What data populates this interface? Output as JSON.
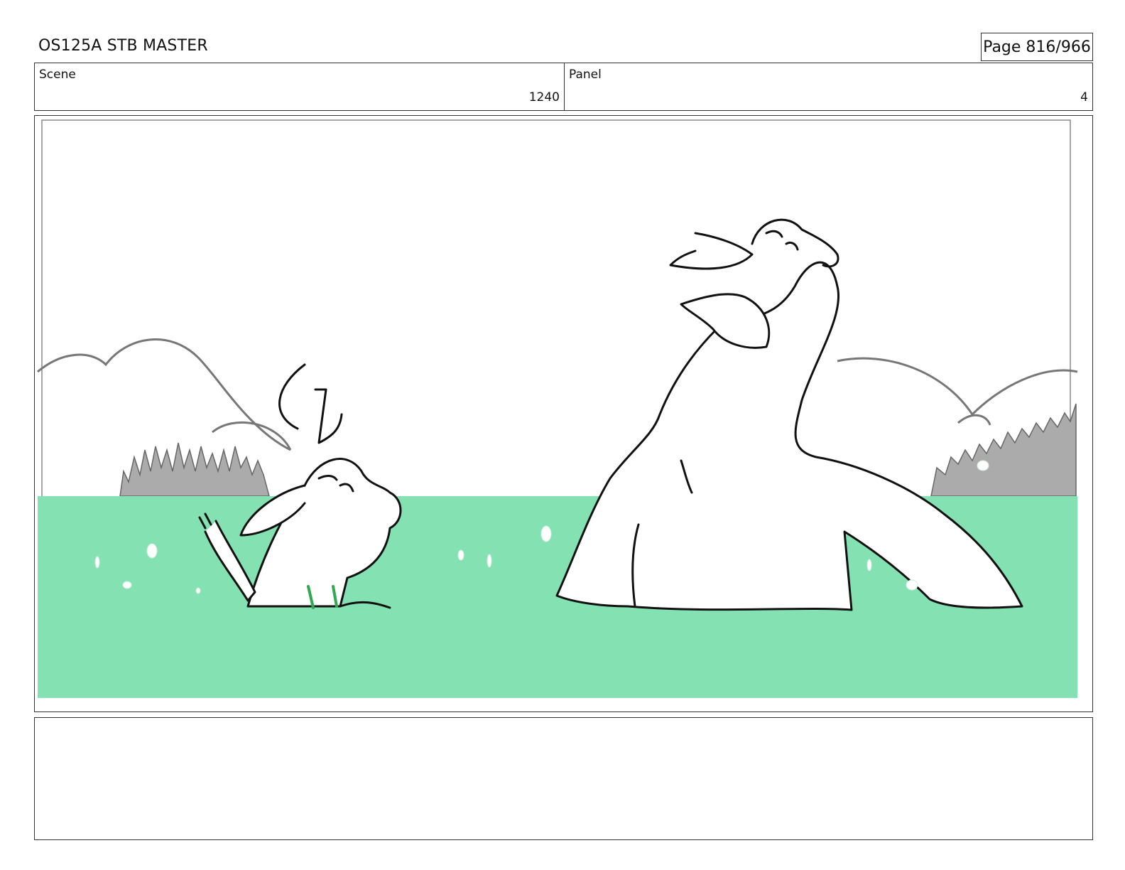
{
  "header": {
    "title": "OS125A STB MASTER",
    "page": "Page 816/966"
  },
  "info": {
    "scene_label": "Scene",
    "scene_value": "1240",
    "panel_label": "Panel",
    "panel_value": "4"
  },
  "artwork": {
    "water_color": "#84e2b2",
    "tree_color": "#ababab",
    "line_color": "#111111"
  },
  "notes": {
    "text": ""
  }
}
